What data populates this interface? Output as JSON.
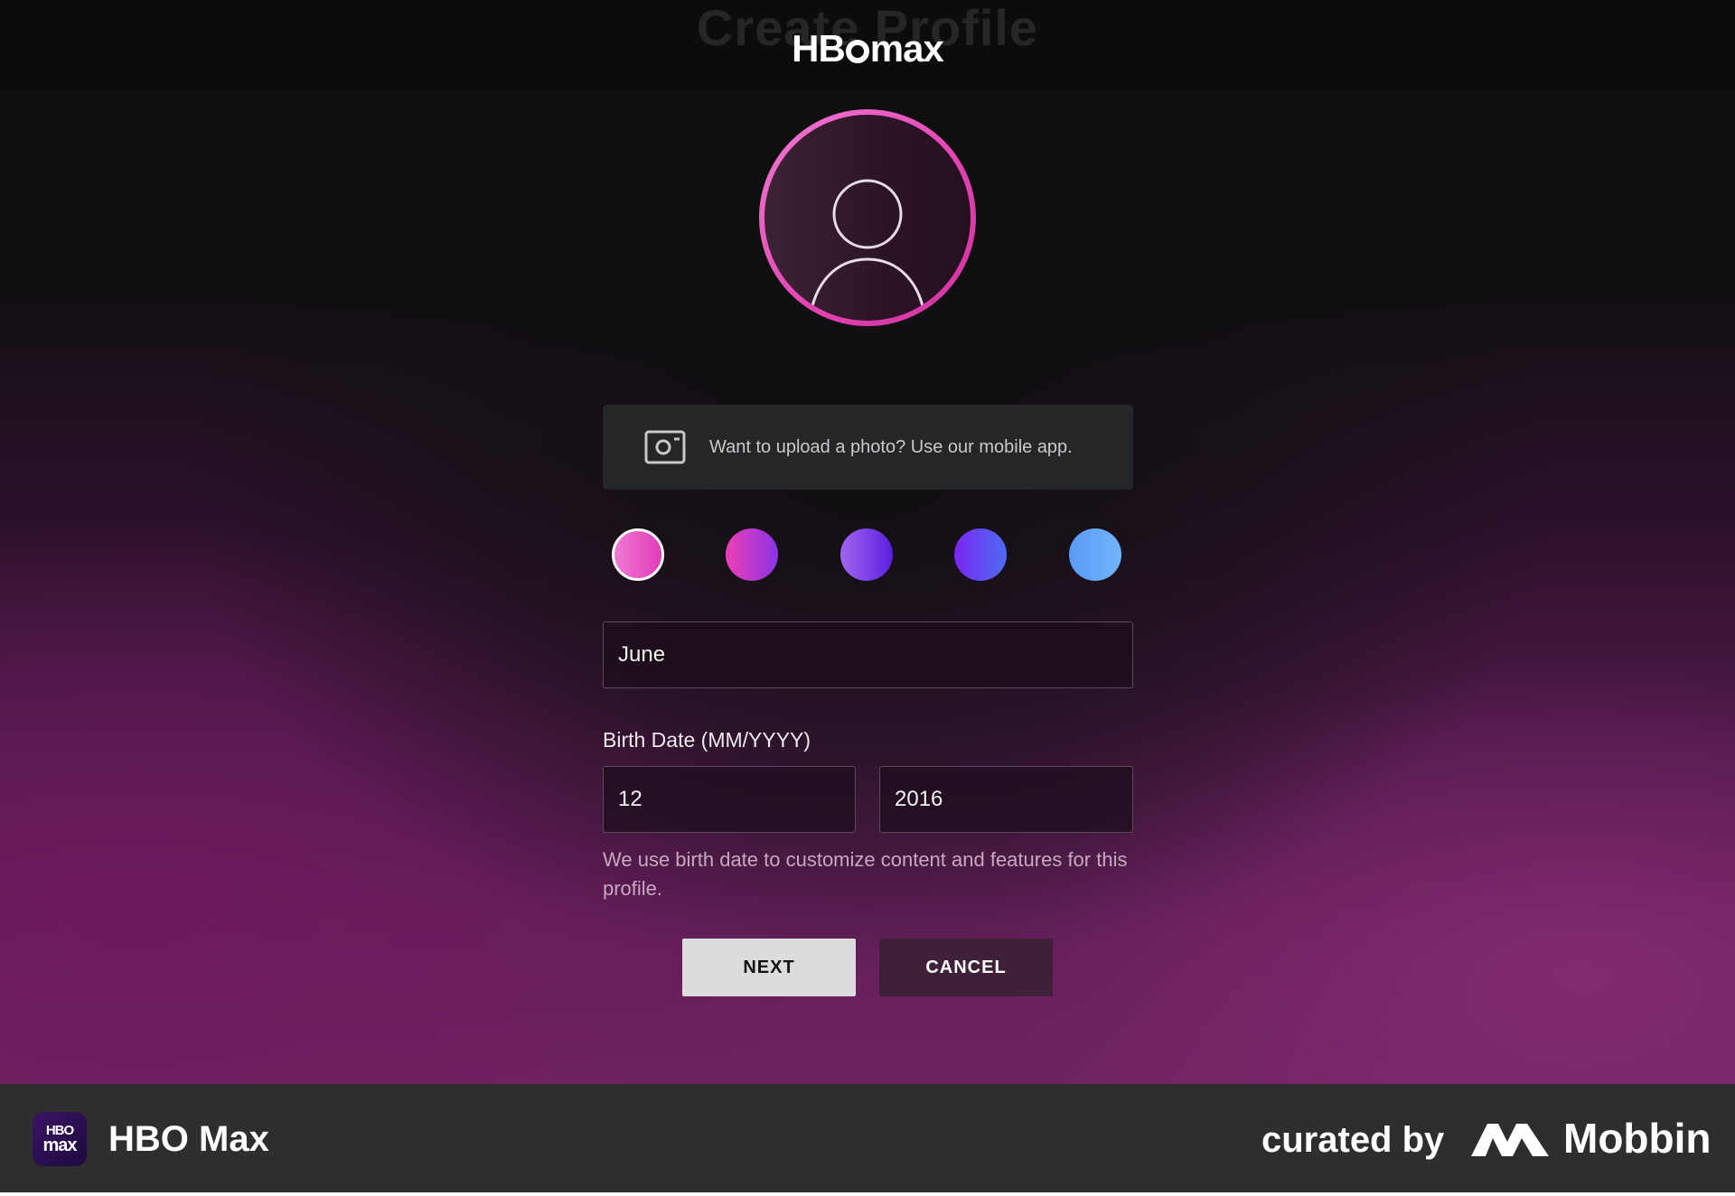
{
  "page": {
    "ghost_title": "Create Profile",
    "logo_parts": [
      "HB",
      "max"
    ]
  },
  "avatar": {
    "icon": "user-silhouette-icon",
    "ring_color": "#e544b4"
  },
  "upload_notice": {
    "icon": "camera-icon",
    "text": "Want to upload a photo? Use our mobile app."
  },
  "color_swatches": [
    {
      "name": "pink",
      "from": "#f07ad4",
      "to": "#e03cb5",
      "selected": true
    },
    {
      "name": "magenta",
      "from": "#ee3fb6",
      "to": "#8b33e6",
      "selected": false
    },
    {
      "name": "purple",
      "from": "#a166ee",
      "to": "#5b1ee0",
      "selected": false
    },
    {
      "name": "violet",
      "from": "#7a25f2",
      "to": "#4e6cf5",
      "selected": false
    },
    {
      "name": "blue",
      "from": "#5a9af6",
      "to": "#71b5fb",
      "selected": false
    }
  ],
  "form": {
    "name_value": "June",
    "birth_date_label": "Birth Date (MM/YYYY)",
    "month_value": "12",
    "year_value": "2016",
    "helper_text": "We use birth date to customize content and features for this profile."
  },
  "buttons": {
    "next": "NEXT",
    "cancel": "CANCEL"
  },
  "footer": {
    "app_icon_line1": "HBO",
    "app_icon_line2": "max",
    "app_name": "HBO Max",
    "curated_by": "curated by",
    "brand": "Mobbin"
  }
}
